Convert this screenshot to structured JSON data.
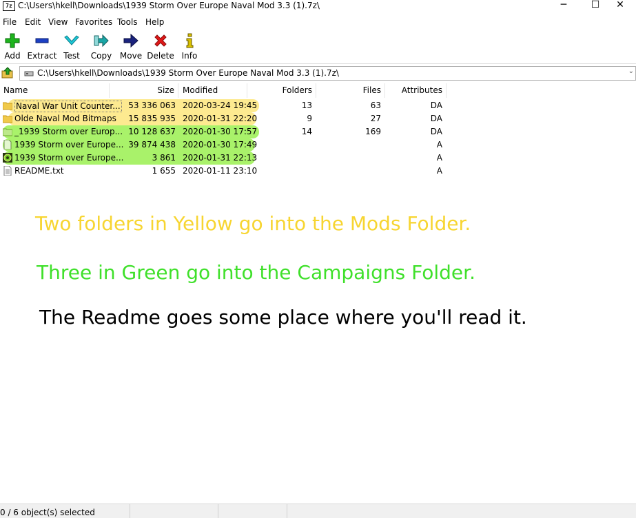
{
  "window": {
    "app_icon_text": "7z",
    "title": "C:\\Users\\hkell\\Downloads\\1939 Storm Over Europe Naval Mod 3.3 (1).7z\\",
    "minimize": "─",
    "maximize": "☐",
    "close": "✕"
  },
  "menu": [
    "File",
    "Edit",
    "View",
    "Favorites",
    "Tools",
    "Help"
  ],
  "toolbar": [
    {
      "label": "Add",
      "icon": "plus-icon",
      "color": "#1db31d"
    },
    {
      "label": "Extract",
      "icon": "minus-icon",
      "color": "#1c3fc4"
    },
    {
      "label": "Test",
      "icon": "check-icon",
      "color": "#1ec8d8"
    },
    {
      "label": "Copy",
      "icon": "copy-arrow-icon",
      "color": "#1aa6a6"
    },
    {
      "label": "Move",
      "icon": "move-arrow-icon",
      "color": "#1a237e"
    },
    {
      "label": "Delete",
      "icon": "delete-x-icon",
      "color": "#e01818"
    },
    {
      "label": "Info",
      "icon": "info-icon",
      "color": "#d8c000"
    }
  ],
  "address": {
    "path": "C:\\Users\\hkell\\Downloads\\1939 Storm Over Europe Naval Mod 3.3 (1).7z\\",
    "dropdown": "⌄"
  },
  "columns": [
    "Name",
    "Size",
    "Modified",
    "Folders",
    "Files",
    "Attributes"
  ],
  "rows": [
    {
      "name": "Naval War Unit Counter...",
      "size": "53 336 063",
      "modified": "2020-03-24 19:45",
      "folders": "13",
      "files": "63",
      "attributes": "DA",
      "icon": "folder-icon",
      "highlight": "yellow"
    },
    {
      "name": "Olde Naval Mod Bitmaps",
      "size": "15 835 935",
      "modified": "2020-01-31 22:20",
      "folders": "9",
      "files": "27",
      "attributes": "DA",
      "icon": "folder-icon",
      "highlight": "yellow"
    },
    {
      "name": "_1939 Storm over Europ...",
      "size": "10 128 637",
      "modified": "2020-01-30 17:57",
      "folders": "14",
      "files": "169",
      "attributes": "DA",
      "icon": "folder-icon",
      "highlight": "green"
    },
    {
      "name": "1939 Storm over Europe...",
      "size": "39 874 438",
      "modified": "2020-01-30 17:49",
      "folders": "",
      "files": "",
      "attributes": "A",
      "icon": "file-icon",
      "highlight": "green"
    },
    {
      "name": "1939 Storm over Europe...",
      "size": "3 861",
      "modified": "2020-01-31 22:13",
      "folders": "",
      "files": "",
      "attributes": "A",
      "icon": "scenario-icon",
      "highlight": "green"
    },
    {
      "name": "README.txt",
      "size": "1 655",
      "modified": "2020-01-11 23:10",
      "folders": "",
      "files": "",
      "attributes": "A",
      "icon": "text-file-icon",
      "highlight": "none"
    }
  ],
  "notes": {
    "yellow": "Two folders in Yellow go into the Mods Folder.",
    "green": "Three in Green go into the Campaigns Folder.",
    "readme": "The Readme goes some place where you'll read it."
  },
  "colors": {
    "yellow_text": "#f7d531",
    "green_text": "#3fe02a",
    "yellow_highlight": "#fde98a",
    "green_highlight": "#a9f26a"
  },
  "status": {
    "selected": "0 / 6 object(s) selected"
  }
}
